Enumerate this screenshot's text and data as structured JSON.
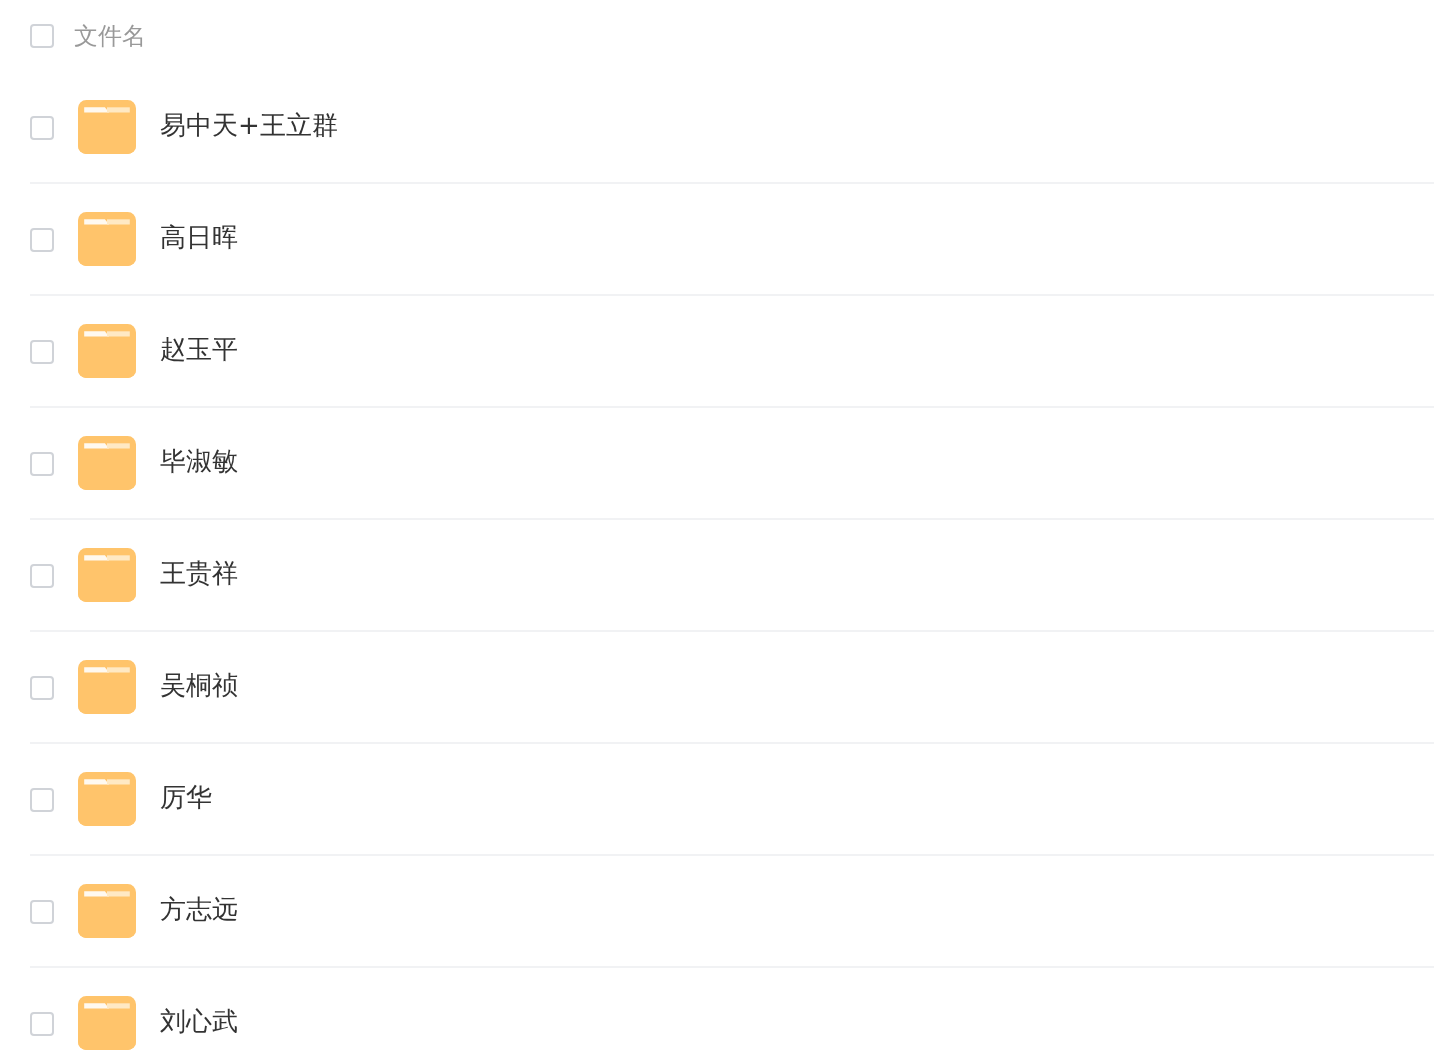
{
  "header": {
    "label": "文件名",
    "checked": false
  },
  "files": [
    {
      "name": "易中天+王立群",
      "checked": false
    },
    {
      "name": "高日晖",
      "checked": false
    },
    {
      "name": "赵玉平",
      "checked": false
    },
    {
      "name": "毕淑敏",
      "checked": false
    },
    {
      "name": "王贵祥",
      "checked": false
    },
    {
      "name": "吴桐祯",
      "checked": false
    },
    {
      "name": "厉华",
      "checked": false
    },
    {
      "name": "方志远",
      "checked": false
    },
    {
      "name": "刘心武",
      "checked": false
    }
  ]
}
